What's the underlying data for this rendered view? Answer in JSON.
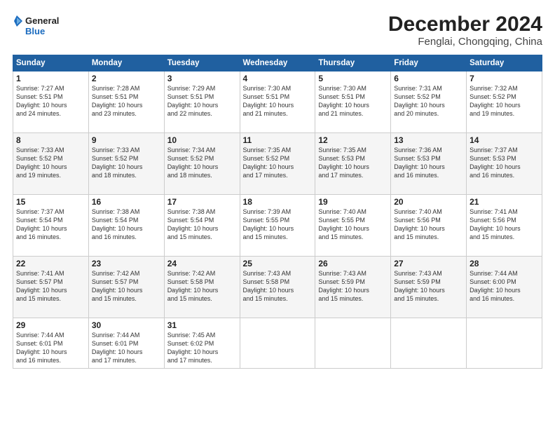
{
  "header": {
    "logo_line1": "General",
    "logo_line2": "Blue",
    "title": "December 2024",
    "subtitle": "Fenglai, Chongqing, China"
  },
  "days_of_week": [
    "Sunday",
    "Monday",
    "Tuesday",
    "Wednesday",
    "Thursday",
    "Friday",
    "Saturday"
  ],
  "weeks": [
    [
      {
        "day": "1",
        "rise": "7:27 AM",
        "set": "5:51 PM",
        "daylight": "10 hours and 24 minutes."
      },
      {
        "day": "2",
        "rise": "7:28 AM",
        "set": "5:51 PM",
        "daylight": "10 hours and 23 minutes."
      },
      {
        "day": "3",
        "rise": "7:29 AM",
        "set": "5:51 PM",
        "daylight": "10 hours and 22 minutes."
      },
      {
        "day": "4",
        "rise": "7:30 AM",
        "set": "5:51 PM",
        "daylight": "10 hours and 21 minutes."
      },
      {
        "day": "5",
        "rise": "7:30 AM",
        "set": "5:51 PM",
        "daylight": "10 hours and 21 minutes."
      },
      {
        "day": "6",
        "rise": "7:31 AM",
        "set": "5:52 PM",
        "daylight": "10 hours and 20 minutes."
      },
      {
        "day": "7",
        "rise": "7:32 AM",
        "set": "5:52 PM",
        "daylight": "10 hours and 19 minutes."
      }
    ],
    [
      {
        "day": "8",
        "rise": "7:33 AM",
        "set": "5:52 PM",
        "daylight": "10 hours and 19 minutes."
      },
      {
        "day": "9",
        "rise": "7:33 AM",
        "set": "5:52 PM",
        "daylight": "10 hours and 18 minutes."
      },
      {
        "day": "10",
        "rise": "7:34 AM",
        "set": "5:52 PM",
        "daylight": "10 hours and 18 minutes."
      },
      {
        "day": "11",
        "rise": "7:35 AM",
        "set": "5:52 PM",
        "daylight": "10 hours and 17 minutes."
      },
      {
        "day": "12",
        "rise": "7:35 AM",
        "set": "5:53 PM",
        "daylight": "10 hours and 17 minutes."
      },
      {
        "day": "13",
        "rise": "7:36 AM",
        "set": "5:53 PM",
        "daylight": "10 hours and 16 minutes."
      },
      {
        "day": "14",
        "rise": "7:37 AM",
        "set": "5:53 PM",
        "daylight": "10 hours and 16 minutes."
      }
    ],
    [
      {
        "day": "15",
        "rise": "7:37 AM",
        "set": "5:54 PM",
        "daylight": "10 hours and 16 minutes."
      },
      {
        "day": "16",
        "rise": "7:38 AM",
        "set": "5:54 PM",
        "daylight": "10 hours and 16 minutes."
      },
      {
        "day": "17",
        "rise": "7:38 AM",
        "set": "5:54 PM",
        "daylight": "10 hours and 15 minutes."
      },
      {
        "day": "18",
        "rise": "7:39 AM",
        "set": "5:55 PM",
        "daylight": "10 hours and 15 minutes."
      },
      {
        "day": "19",
        "rise": "7:40 AM",
        "set": "5:55 PM",
        "daylight": "10 hours and 15 minutes."
      },
      {
        "day": "20",
        "rise": "7:40 AM",
        "set": "5:56 PM",
        "daylight": "10 hours and 15 minutes."
      },
      {
        "day": "21",
        "rise": "7:41 AM",
        "set": "5:56 PM",
        "daylight": "10 hours and 15 minutes."
      }
    ],
    [
      {
        "day": "22",
        "rise": "7:41 AM",
        "set": "5:57 PM",
        "daylight": "10 hours and 15 minutes."
      },
      {
        "day": "23",
        "rise": "7:42 AM",
        "set": "5:57 PM",
        "daylight": "10 hours and 15 minutes."
      },
      {
        "day": "24",
        "rise": "7:42 AM",
        "set": "5:58 PM",
        "daylight": "10 hours and 15 minutes."
      },
      {
        "day": "25",
        "rise": "7:43 AM",
        "set": "5:58 PM",
        "daylight": "10 hours and 15 minutes."
      },
      {
        "day": "26",
        "rise": "7:43 AM",
        "set": "5:59 PM",
        "daylight": "10 hours and 15 minutes."
      },
      {
        "day": "27",
        "rise": "7:43 AM",
        "set": "5:59 PM",
        "daylight": "10 hours and 15 minutes."
      },
      {
        "day": "28",
        "rise": "7:44 AM",
        "set": "6:00 PM",
        "daylight": "10 hours and 16 minutes."
      }
    ],
    [
      {
        "day": "29",
        "rise": "7:44 AM",
        "set": "6:01 PM",
        "daylight": "10 hours and 16 minutes."
      },
      {
        "day": "30",
        "rise": "7:44 AM",
        "set": "6:01 PM",
        "daylight": "10 hours and 17 minutes."
      },
      {
        "day": "31",
        "rise": "7:45 AM",
        "set": "6:02 PM",
        "daylight": "10 hours and 17 minutes."
      },
      null,
      null,
      null,
      null
    ]
  ],
  "labels": {
    "sunrise": "Sunrise:",
    "sunset": "Sunset:",
    "daylight": "Daylight:"
  }
}
